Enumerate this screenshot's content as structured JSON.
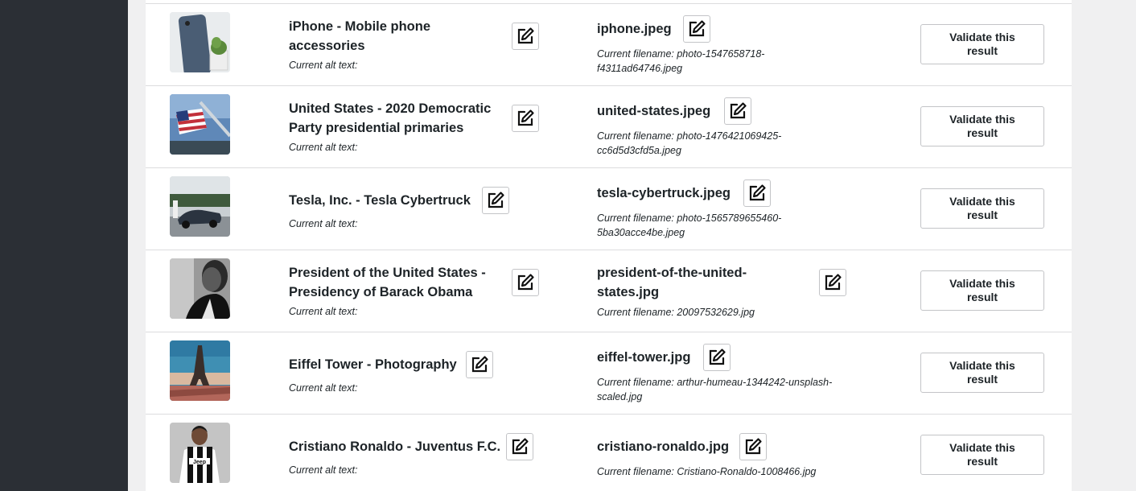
{
  "page": {
    "sidebar_color": "#2b2f35",
    "panel_color": "#ffffff"
  },
  "rows": [
    {
      "title": "iPhone - Mobile phone accessories",
      "alt_label": "Current alt text:",
      "filename": "iphone.jpeg",
      "current_filename": "Current filename: photo-1547658718-f4311ad64746.jpeg",
      "validate_label": "Validate this result",
      "thumb_icon": "iphone-photo"
    },
    {
      "title": "United States - 2020 Democratic Party presidential primaries",
      "alt_label": "Current alt text:",
      "filename": "united-states.jpeg",
      "current_filename": "Current filename: photo-1476421069425-cc6d5d3cfd5a.jpeg",
      "validate_label": "Validate this result",
      "thumb_icon": "us-flag-photo"
    },
    {
      "title": "Tesla, Inc. - Tesla Cybertruck",
      "alt_label": "Current alt text:",
      "filename": "tesla-cybertruck.jpeg",
      "current_filename": "Current filename: photo-1565789655460-5ba30acce4be.jpeg",
      "validate_label": "Validate this result",
      "thumb_icon": "tesla-car-photo"
    },
    {
      "title": "President of the United States - Presidency of Barack Obama",
      "alt_label": "Current alt text:",
      "filename": "president-of-the-united-states.jpg",
      "current_filename": "Current filename: 20097532629.jpg",
      "validate_label": "Validate this result",
      "thumb_icon": "portrait-photo"
    },
    {
      "title": "Eiffel Tower - Photography",
      "alt_label": "Current alt text:",
      "filename": "eiffel-tower.jpg",
      "current_filename": "Current filename: arthur-humeau-1344242-unsplash-scaled.jpg",
      "validate_label": "Validate this result",
      "thumb_icon": "eiffel-tower-photo"
    },
    {
      "title": "Cristiano Ronaldo - Juventus F.C.",
      "alt_label": "Current alt text:",
      "filename": "cristiano-ronaldo.jpg",
      "current_filename": "Current filename: Cristiano-Ronaldo-1008466.jpg",
      "validate_label": "Validate this result",
      "thumb_icon": "football-player-photo"
    }
  ]
}
